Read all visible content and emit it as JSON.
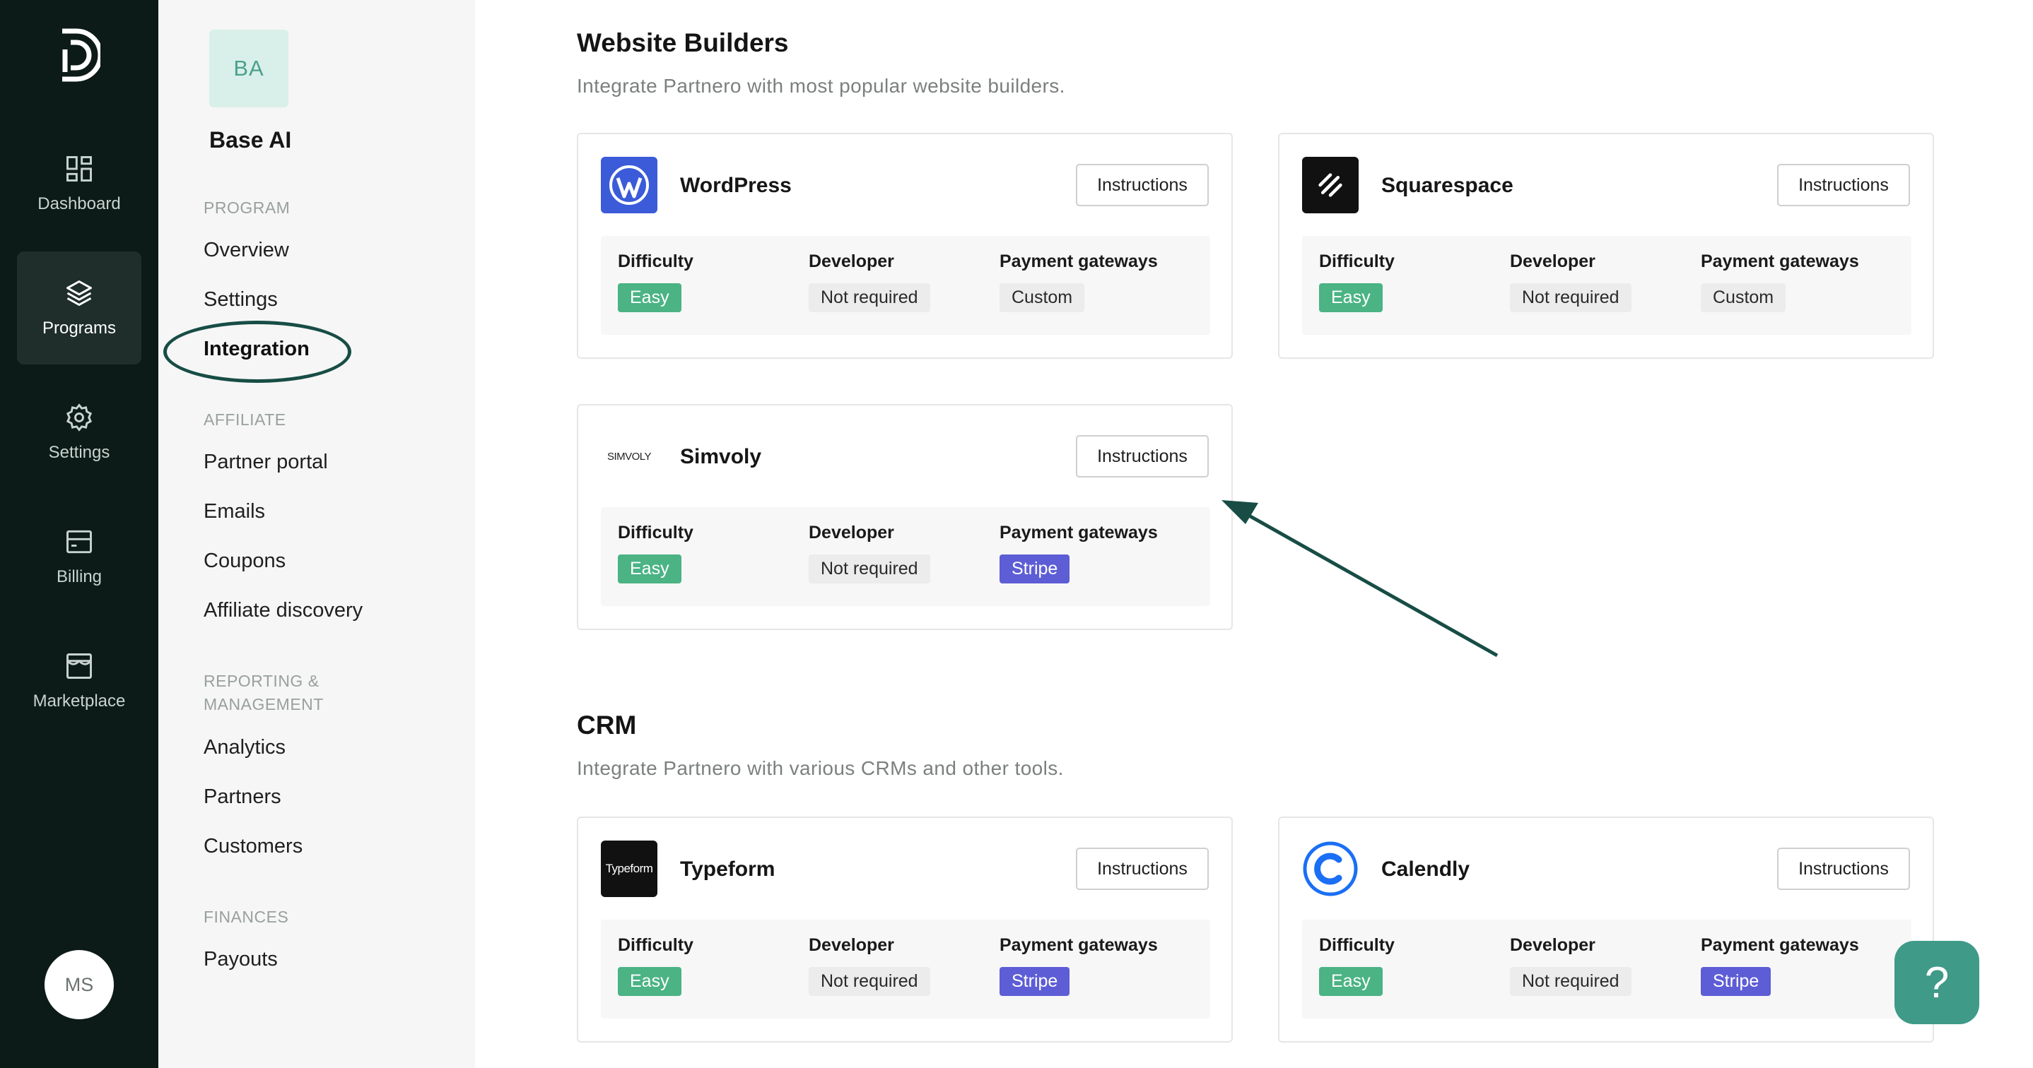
{
  "rail": {
    "items": [
      {
        "label": "Dashboard",
        "icon": "dashboard-icon"
      },
      {
        "label": "Programs",
        "icon": "layers-icon"
      },
      {
        "label": "Settings",
        "icon": "gear-icon"
      },
      {
        "label": "Billing",
        "icon": "card-icon"
      },
      {
        "label": "Marketplace",
        "icon": "store-icon"
      }
    ],
    "avatar": "MS"
  },
  "sidebar": {
    "org_initials": "BA",
    "org_name": "Base AI",
    "program_title": "PROGRAM",
    "program_items": [
      "Overview",
      "Settings",
      "Integration"
    ],
    "affiliate_title": "AFFILIATE",
    "affiliate_items": [
      "Partner portal",
      "Emails",
      "Coupons",
      "Affiliate discovery"
    ],
    "reporting_title_1": "REPORTING &",
    "reporting_title_2": "MANAGEMENT",
    "reporting_items": [
      "Analytics",
      "Partners",
      "Customers"
    ],
    "finances_title": "FINANCES",
    "finances_items": [
      "Payouts"
    ]
  },
  "labels": {
    "instructions": "Instructions",
    "difficulty": "Difficulty",
    "developer": "Developer",
    "payment_gateways": "Payment gateways"
  },
  "website_builders": {
    "title": "Website Builders",
    "subtitle": "Integrate Partnero with most popular website builders.",
    "cards": [
      {
        "name": "WordPress",
        "difficulty": "Easy",
        "developer": "Not required",
        "gateway": "Custom"
      },
      {
        "name": "Squarespace",
        "difficulty": "Easy",
        "developer": "Not required",
        "gateway": "Custom"
      },
      {
        "name": "Simvoly",
        "logo_text": "SIMVOLY",
        "difficulty": "Easy",
        "developer": "Not required",
        "gateway": "Stripe"
      }
    ]
  },
  "crm": {
    "title": "CRM",
    "subtitle": "Integrate Partnero with various CRMs and other tools.",
    "cards": [
      {
        "name": "Typeform",
        "logo_text": "Typeform",
        "difficulty": "Easy",
        "developer": "Not required",
        "gateway": "Stripe"
      },
      {
        "name": "Calendly",
        "difficulty": "Easy",
        "developer": "Not required",
        "gateway": "Stripe"
      }
    ]
  },
  "help_button": "?",
  "colors": {
    "rail_bg": "#0c1b17",
    "accent_green": "#4bb384",
    "stripe_purple": "#5d5dd6",
    "annotation": "#174d45"
  }
}
